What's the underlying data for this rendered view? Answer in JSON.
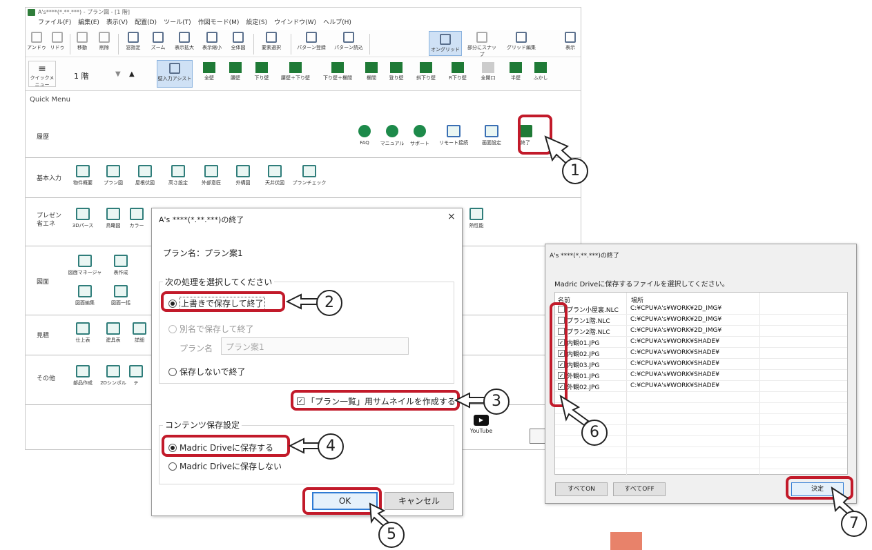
{
  "app": {
    "title": "A's****(*.**.***) - プラン図 - [1 階]",
    "menus": [
      "ファイル(F)",
      "編集(E)",
      "表示(V)",
      "配置(D)",
      "ツール(T)",
      "作図モード(M)",
      "設定(S)",
      "ウインドウ(W)",
      "ヘルプ(H)"
    ],
    "toolbar1": [
      "アンドゥ",
      "リドゥ",
      "移動",
      "削除",
      "窓指定",
      "ズーム",
      "表示拡大",
      "表示縮小",
      "全体図",
      "要素選択",
      "パターン登録",
      "パターン読込",
      "オングリッド",
      "部分にスナップ",
      "グリッド編集",
      "表示"
    ],
    "toolbar2": {
      "quick_menu": "クイックメニュー",
      "floor": "1 階",
      "walls": [
        "壁入力アシスト",
        "全壁",
        "腰壁",
        "下り壁",
        "腰壁＋下り壁",
        "下り壁＋欄間",
        "欄間",
        "登り壁",
        "斜下り壁",
        "R下り壁",
        "全開口",
        "半壁",
        "ふかし"
      ]
    },
    "quick_menu_label": "Quick Menu",
    "rows": [
      {
        "label": "履歴",
        "items": [
          "FAQ",
          "マニュアル",
          "サポート",
          "リモート接続",
          "画面設定",
          "終了"
        ]
      },
      {
        "label": "基本入力",
        "items": [
          "物件概要",
          "プラン図",
          "屋根伏図",
          "高さ設定",
          "外部意匠",
          "外構図",
          "天井伏図",
          "プランチェック"
        ]
      },
      {
        "label": "プレゼン 省エネ",
        "items": [
          "3Dパース",
          "鳥瞰図",
          "カラー",
          "熱性能"
        ]
      },
      {
        "label": "図面",
        "items": [
          "図面マネージャ",
          "表作成",
          "図面編集",
          "図面一括"
        ]
      },
      {
        "label": "見積",
        "items": [
          "仕上表",
          "建具表",
          "詳細"
        ]
      },
      {
        "label": "その他",
        "items": [
          "部品作成",
          "2Dシンボル",
          "テ"
        ]
      }
    ],
    "youtube": "YouTube"
  },
  "dialog1": {
    "title": "A's ****(*.**.***)の終了",
    "close": "×",
    "plan_name_line": "プラン名：プラン案1",
    "group1_title": "次の処理を選択してください",
    "opt_overwrite": "上書きで保存して終了",
    "opt_saveas": "別名で保存して終了",
    "plan_label": "プラン名",
    "plan_value": "プラン案1",
    "opt_nosave": "保存しないで終了",
    "thumbnail": "「プラン一覧」用サムネイルを作成する",
    "group2_title": "コンテンツ保存設定",
    "opt_drive_save": "Madric Driveに保存する",
    "opt_drive_nosave": "Madric Driveに保存しない",
    "ok": "OK",
    "cancel": "キャンセル"
  },
  "dialog2": {
    "title": "A's ****(*.**.***)の終了",
    "prompt": "Madric Driveに保存するファイルを選択してください。",
    "col_name": "名前",
    "col_path": "場所",
    "files": [
      {
        "name": "プラン小屋裏.NLC",
        "path": "C:¥CPU¥A's¥WORK¥2D_IMG¥",
        "checked": false
      },
      {
        "name": "プラン1階.NLC",
        "path": "C:¥CPU¥A's¥WORK¥2D_IMG¥",
        "checked": false
      },
      {
        "name": "プラン2階.NLC",
        "path": "C:¥CPU¥A's¥WORK¥2D_IMG¥",
        "checked": false
      },
      {
        "name": "内観01.JPG",
        "path": "C:¥CPU¥A's¥WORK¥SHADE¥",
        "checked": true
      },
      {
        "name": "内観02.JPG",
        "path": "C:¥CPU¥A's¥WORK¥SHADE¥",
        "checked": true
      },
      {
        "name": "内観03.JPG",
        "path": "C:¥CPU¥A's¥WORK¥SHADE¥",
        "checked": true
      },
      {
        "name": "外観01.JPG",
        "path": "C:¥CPU¥A's¥WORK¥SHADE¥",
        "checked": true
      },
      {
        "name": "外観02.JPG",
        "path": "C:¥CPU¥A's¥WORK¥SHADE¥",
        "checked": true
      }
    ],
    "all_on": "すべてON",
    "all_off": "すべてOFF",
    "decide": "決定"
  },
  "callouts": [
    "1",
    "2",
    "3",
    "4",
    "5",
    "6",
    "7"
  ],
  "colors": {
    "highlight": "#c21a2a",
    "accent": "#2e7bd4",
    "wall_green": "#1f7a36"
  }
}
